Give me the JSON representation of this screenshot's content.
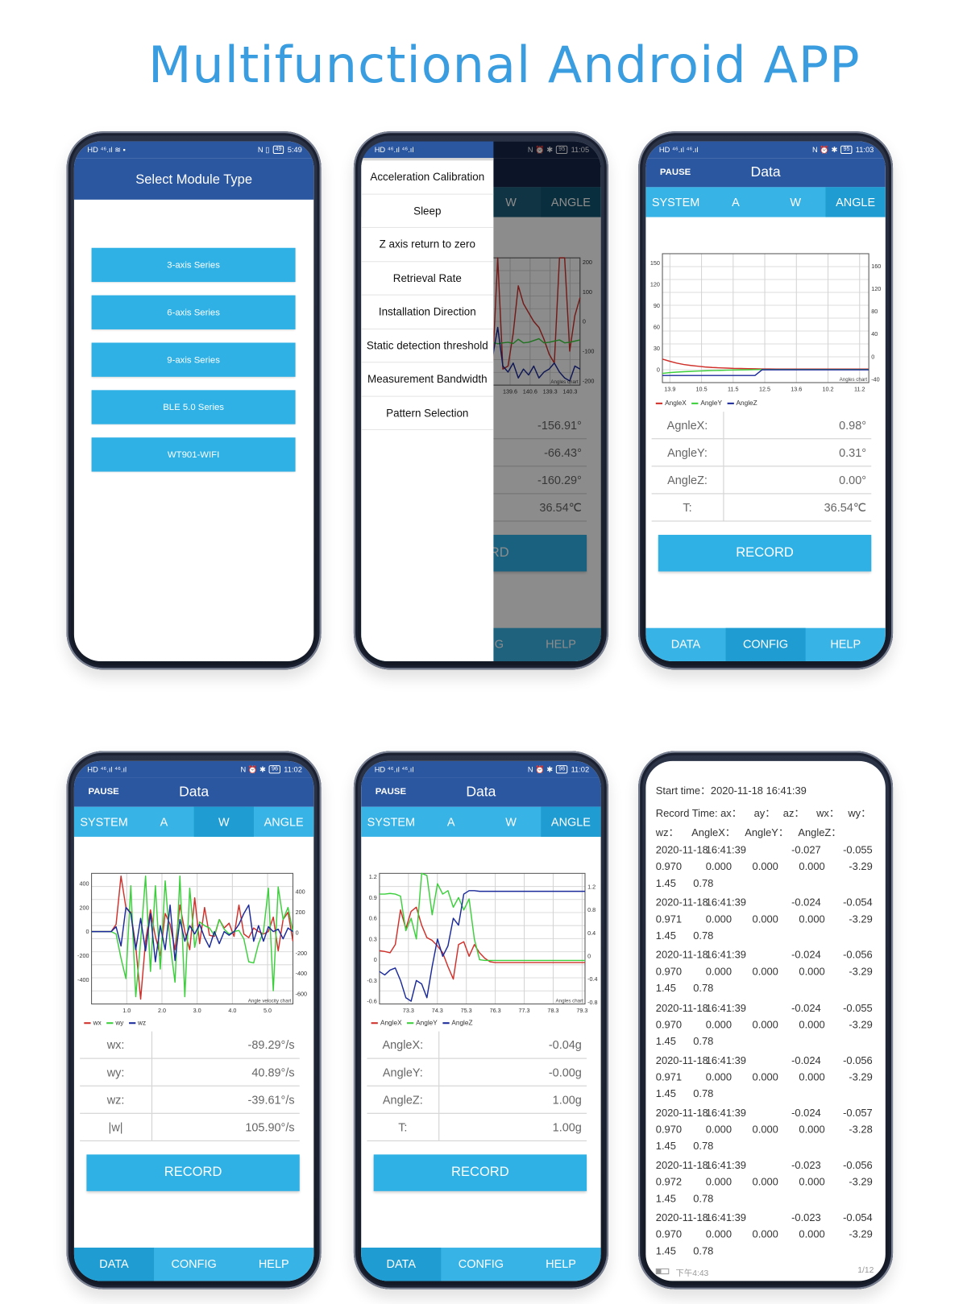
{
  "title": "Multifunctional Android APP",
  "colors": {
    "header": "#2b56a0",
    "tab": "#38b3e5",
    "tab_selected": "#1f9dd2",
    "button": "#2fb1e6",
    "title": "#3a9de0",
    "series_red": "#d0302a",
    "series_green": "#3ccf3c",
    "series_blue": "#1b2a9a"
  },
  "phones": {
    "p1": {
      "status": {
        "left_icons": "HD ⁴⁶.ıl ≋ ▪",
        "right_icons": "N ▯ ",
        "battery": "49",
        "time": "5:49"
      },
      "header_title": "Select Module Type",
      "modules": [
        "3-axis Series",
        "6-axis Series",
        "9-axis Series",
        "BLE 5.0 Series",
        "WT901-WIFI"
      ]
    },
    "p2": {
      "status": {
        "left_icons": "HD ⁴⁶.ıl ⁴⁶.ıl",
        "right_icons": "N ⏰ ✱",
        "battery": "95",
        "time": "11:05"
      },
      "menu": [
        "Acceleration Calibration",
        "Sleep",
        "Z axis return to zero",
        "Retrieval Rate",
        "Installation Direction",
        "Static detection threshold",
        "Measurement Bandwidth",
        "Pattern Selection"
      ],
      "tabs": [
        "",
        "",
        "W",
        "ANGLE"
      ],
      "values": [
        "-156.91°",
        "-66.43°",
        "-160.29°",
        "36.54℃"
      ],
      "record_label": "RECORD",
      "nav": [
        "",
        "CONFIG",
        "HELP"
      ]
    },
    "p3": {
      "status": {
        "left_icons": "HD ⁴⁶.ıl ⁴⁶.ıl",
        "right_icons": "N ⏰ ✱",
        "battery": "95",
        "time": "11:03"
      },
      "pause_label": "PAUSE",
      "header_title": "Data",
      "tabs": [
        "SYSTEM",
        "A",
        "W",
        "ANGLE"
      ],
      "selected_tab": 3,
      "table": [
        {
          "label": "AgnleX:",
          "value": "0.98°"
        },
        {
          "label": "AngleY:",
          "value": "0.31°"
        },
        {
          "label": "AngleZ:",
          "value": "0.00°"
        },
        {
          "label": "T:",
          "value": "36.54℃"
        }
      ],
      "record_label": "RECORD",
      "nav": [
        "DATA",
        "CONFIG",
        "HELP"
      ],
      "selected_nav": 1
    },
    "p4": {
      "status": {
        "left_icons": "HD ⁴⁶.ıl ⁴⁶.ıl",
        "right_icons": "N ⏰ ✱",
        "battery": "96",
        "time": "11:02"
      },
      "pause_label": "PAUSE",
      "header_title": "Data",
      "tabs": [
        "SYSTEM",
        "A",
        "W",
        "ANGLE"
      ],
      "selected_tab": 2,
      "table": [
        {
          "label": "wx:",
          "value": "-89.29°/s"
        },
        {
          "label": "wy:",
          "value": "40.89°/s"
        },
        {
          "label": "wz:",
          "value": "-39.61°/s"
        },
        {
          "label": "|w|",
          "value": "105.90°/s"
        }
      ],
      "record_label": "RECORD",
      "nav": [
        "DATA",
        "CONFIG",
        "HELP"
      ],
      "selected_nav": 0
    },
    "p5": {
      "status": {
        "left_icons": "HD ⁴⁶.ıl ⁴⁶.ıl",
        "right_icons": "N ⏰ ✱",
        "battery": "96",
        "time": "11:02"
      },
      "pause_label": "PAUSE",
      "header_title": "Data",
      "tabs": [
        "SYSTEM",
        "A",
        "W",
        "ANGLE"
      ],
      "selected_tab": 3,
      "table": [
        {
          "label": "AngleX:",
          "value": "-0.04g"
        },
        {
          "label": "AngleY:",
          "value": "-0.00g"
        },
        {
          "label": "AngleZ:",
          "value": "1.00g"
        },
        {
          "label": "T:",
          "value": "1.00g"
        }
      ],
      "record_label": "RECORD",
      "nav": [
        "DATA",
        "CONFIG",
        "HELP"
      ],
      "selected_nav": 0
    },
    "p6": {
      "start_time": "Start time：2020-11-18 16:41:39",
      "header_line1": [
        "Record Time: ax：",
        "ay：",
        "az：",
        "wx：",
        "wy："
      ],
      "header_line2": [
        "wz：",
        "AngleX：",
        "AngleY：",
        "AngleZ："
      ],
      "records": [
        {
          "date": "2020-11-18",
          "time": "16:41:39",
          "c1": "-0.027",
          "c2": "-0.055",
          "l2": [
            "0.970",
            "0.000",
            "0.000",
            "0.000",
            "-3.29"
          ],
          "l3": [
            "1.45",
            "0.78"
          ]
        },
        {
          "date": "2020-11-18",
          "time": "16:41:39",
          "c1": "-0.024",
          "c2": "-0.054",
          "l2": [
            "0.971",
            "0.000",
            "0.000",
            "0.000",
            "-3.29"
          ],
          "l3": [
            "1.45",
            "0.78"
          ]
        },
        {
          "date": "2020-11-18",
          "time": "16:41:39",
          "c1": "-0.024",
          "c2": "-0.056",
          "l2": [
            "0.970",
            "0.000",
            "0.000",
            "0.000",
            "-3.29"
          ],
          "l3": [
            "1.45",
            "0.78"
          ]
        },
        {
          "date": "2020-11-18",
          "time": "16:41:39",
          "c1": "-0.024",
          "c2": "-0.055",
          "l2": [
            "0.970",
            "0.000",
            "0.000",
            "0.000",
            "-3.29"
          ],
          "l3": [
            "1.45",
            "0.78"
          ]
        },
        {
          "date": "2020-11-18",
          "time": "16:41:39",
          "c1": "-0.024",
          "c2": "-0.056",
          "l2": [
            "0.971",
            "0.000",
            "0.000",
            "0.000",
            "-3.29"
          ],
          "l3": [
            "1.45",
            "0.78"
          ]
        },
        {
          "date": "2020-11-18",
          "time": "16:41:39",
          "c1": "-0.024",
          "c2": "-0.057",
          "l2": [
            "0.970",
            "0.000",
            "0.000",
            "0.000",
            "-3.28"
          ],
          "l3": [
            "1.45",
            "0.78"
          ]
        },
        {
          "date": "2020-11-18",
          "time": "16:41:39",
          "c1": "-0.023",
          "c2": "-0.056",
          "l2": [
            "0.972",
            "0.000",
            "0.000",
            "0.000",
            "-3.29"
          ],
          "l3": [
            "1.45",
            "0.78"
          ]
        },
        {
          "date": "2020-11-18",
          "time": "16:41:39",
          "c1": "-0.023",
          "c2": "-0.054",
          "l2": [
            "0.970",
            "0.000",
            "0.000",
            "0.000",
            "-3.29"
          ],
          "l3": [
            "1.45",
            "0.78"
          ]
        }
      ],
      "footer_time": "下午4:43",
      "footer_page": "1/12"
    }
  },
  "chart_data": [
    {
      "id": "p2",
      "type": "line",
      "chart_label": "Angles chart",
      "grid": true,
      "legend": "none",
      "xlim": [
        -0.54,
        9.5
      ],
      "x_ticks": [
        {
          "x": 6,
          "label": "139.6"
        },
        {
          "x": 7,
          "label": "140.6"
        },
        {
          "x": 8,
          "label": "139.3"
        },
        {
          "x": 9,
          "label": "140.3"
        }
      ],
      "y_ticks_left": [],
      "ylim_left": [
        -214,
        214
      ],
      "y_ticks_right": [
        200,
        100,
        0,
        -100,
        -200
      ],
      "ylim_right": [
        -214,
        214
      ],
      "series": [
        {
          "color": "#d0302a",
          "y": [
            -100,
            -90,
            -120,
            -80,
            -60,
            -100,
            -140,
            -120,
            -90,
            -60,
            -80,
            -120,
            -140,
            -100,
            -90,
            -110,
            -130,
            -150,
            -140,
            -120,
            -130,
            -140,
            -150,
            214,
            -160,
            -150,
            -40,
            120,
            60,
            30,
            0,
            -20,
            -60,
            -110,
            -140,
            214,
            214,
            -100,
            20,
            80
          ]
        },
        {
          "color": "#3ccf3c",
          "y": [
            -70,
            -65,
            -75,
            -70,
            -60,
            -72,
            -68,
            -70,
            -74,
            -66,
            -70,
            -72,
            -68,
            -65,
            -70,
            -75,
            -70,
            -68,
            -72,
            -70,
            -66,
            -62,
            -70,
            -75,
            -72,
            -70,
            -74,
            -60,
            -72,
            -70,
            -64,
            -58,
            -72,
            -70,
            -66,
            -62,
            -72,
            -70,
            -66,
            -62
          ]
        },
        {
          "color": "#1b2a9a",
          "y": [
            -150,
            -160,
            -140,
            -170,
            -150,
            -160,
            -180,
            -150,
            -140,
            -160,
            -170,
            -150,
            -160,
            -140,
            -170,
            -150,
            -160,
            -170,
            -140,
            -150,
            -160,
            -150,
            -120,
            -20,
            -150,
            -170,
            -140,
            -190,
            -160,
            -180,
            -150,
            -190,
            -170,
            -160,
            -140,
            -170,
            -190,
            -200,
            -150,
            -160
          ]
        }
      ]
    },
    {
      "id": "p3",
      "type": "line",
      "chart_label": "Angles chart",
      "grid": true,
      "legend": "bottom",
      "xlim": [
        -0.237,
        6.29
      ],
      "x_ticks": [
        {
          "x": 0,
          "label": "13.9"
        },
        {
          "x": 1,
          "label": "10.5"
        },
        {
          "x": 2,
          "label": "11.5"
        },
        {
          "x": 3,
          "label": "12.5"
        },
        {
          "x": 4,
          "label": "13.6"
        },
        {
          "x": 5,
          "label": "10.2"
        },
        {
          "x": 6,
          "label": "11.2"
        }
      ],
      "y_ticks_left": [
        150,
        120,
        90,
        60,
        30,
        0
      ],
      "ylim_left": [
        -18,
        163
      ],
      "y_ticks_right": [
        160,
        120,
        80,
        40,
        0,
        -40
      ],
      "ylim_right": [
        -46,
        182
      ],
      "series": [
        {
          "name": "AngleX",
          "color": "#d0302a",
          "y": [
            15,
            12,
            9.5,
            7.5,
            6,
            5,
            4,
            3.3,
            2.8,
            2.4,
            2,
            1.8,
            1.6,
            1.4,
            1.2,
            1.1,
            1,
            1,
            1,
            1,
            1,
            1,
            1,
            1,
            1,
            1,
            1,
            1,
            1,
            1
          ]
        },
        {
          "name": "AngleY",
          "color": "#3ccf3c",
          "y": [
            -5,
            -4,
            -3.3,
            -2.7,
            -2.2,
            -1.8,
            -1.4,
            -1.1,
            -0.8,
            -0.5,
            -0.3,
            -0.1,
            0,
            0.2,
            0.3,
            0.3,
            0.3,
            0.3,
            0.3,
            0.3,
            0.3,
            0.3,
            0.3,
            0.3,
            0.3,
            0.3,
            0.3,
            0.3,
            0.3,
            0.3
          ]
        },
        {
          "name": "AngleZ",
          "color": "#1b2a9a",
          "y": [
            -8,
            -8,
            -8,
            -8,
            -8,
            -8,
            -8,
            -8,
            -8,
            -8,
            -8,
            -8,
            -8,
            -8,
            0,
            0,
            0,
            0,
            0,
            0,
            0,
            0,
            0,
            0,
            0,
            0,
            0,
            0,
            0,
            0
          ]
        }
      ]
    },
    {
      "id": "p4",
      "type": "line",
      "chart_label": "Angle velocity chart",
      "grid": true,
      "legend": "bottom",
      "xlim": [
        0,
        5.72
      ],
      "x_ticks": [
        {
          "x": 1,
          "label": "1.0"
        },
        {
          "x": 2,
          "label": "2.0"
        },
        {
          "x": 3,
          "label": "3.0"
        },
        {
          "x": 4,
          "label": "4.0"
        },
        {
          "x": 5,
          "label": "5.0"
        }
      ],
      "y_ticks_left": [
        400,
        200,
        0,
        -200,
        -400
      ],
      "ylim_left": [
        -600,
        483
      ],
      "y_ticks_right": [
        400,
        200,
        0,
        -200,
        -400,
        -600
      ],
      "ylim_right": [
        -698,
        579
      ],
      "series": [
        {
          "name": "wx",
          "color": "#d0302a",
          "y": [
            0,
            0,
            0,
            0,
            0,
            60,
            460,
            200,
            160,
            -120,
            -560,
            -80,
            180,
            -40,
            -200,
            150,
            60,
            -150,
            220,
            0,
            -150,
            280,
            -100,
            200,
            -30,
            -40,
            100,
            30,
            70,
            -40,
            220,
            -20,
            -50,
            30,
            0,
            -20,
            0,
            120,
            -160,
            100,
            160,
            -80
          ]
        },
        {
          "name": "wy",
          "color": "#3ccf3c",
          "y": [
            0,
            0,
            0,
            0,
            0,
            -20,
            -220,
            -390,
            380,
            -540,
            -80,
            460,
            -330,
            380,
            -310,
            420,
            -100,
            -420,
            460,
            -540,
            360,
            -130,
            80,
            50,
            30,
            -30,
            100,
            20,
            -20,
            0,
            10,
            -60,
            -250,
            -260,
            -100,
            0,
            360,
            -490,
            370,
            100,
            200,
            0
          ]
        },
        {
          "name": "wz",
          "color": "#1b2a9a",
          "y": [
            0,
            0,
            0,
            0,
            0,
            40,
            -120,
            200,
            150,
            -150,
            110,
            -160,
            150,
            -250,
            50,
            -150,
            220,
            -240,
            100,
            -80,
            50,
            -20,
            60,
            -50,
            -130,
            0,
            -100,
            0,
            -30,
            0,
            60,
            150,
            220,
            -80,
            50,
            -80,
            40,
            0,
            20,
            -60,
            30,
            0
          ]
        }
      ]
    },
    {
      "id": "p5",
      "type": "line",
      "chart_label": "Angles chart",
      "grid": true,
      "legend": "bottom",
      "xlim": [
        72.3,
        79.4
      ],
      "x_ticks": [
        {
          "x": 73.3,
          "label": "73.3"
        },
        {
          "x": 74.3,
          "label": "74.3"
        },
        {
          "x": 75.3,
          "label": "75.3"
        },
        {
          "x": 76.3,
          "label": "76.3"
        },
        {
          "x": 77.3,
          "label": "77.3"
        },
        {
          "x": 78.3,
          "label": "78.3"
        },
        {
          "x": 79.3,
          "label": "79.3"
        }
      ],
      "y_ticks_left": [
        1.2,
        0.9,
        0.6,
        0.3,
        0.0,
        -0.3,
        -0.6
      ],
      "ylim_left": [
        -0.64,
        1.25
      ],
      "y_ticks_right": [
        1.2,
        0.8,
        0.4,
        0.0,
        -0.4,
        -0.8
      ],
      "ylim_right": [
        -0.83,
        1.43
      ],
      "series": [
        {
          "name": "AngleX",
          "color": "#d0302a",
          "y": [
            0.13,
            0.12,
            0.1,
            0.22,
            0.72,
            0.45,
            0.7,
            0.76,
            0.5,
            0.32,
            0.28,
            0.2,
            0.1,
            -0.1,
            -0.28,
            0.22,
            0.26,
            0.05,
            0.22,
            0.1,
            0.02,
            -0.03,
            -0.04,
            -0.04,
            -0.04,
            -0.04,
            -0.04,
            -0.04,
            -0.04,
            -0.04,
            -0.04,
            -0.04,
            -0.04,
            -0.04,
            -0.04,
            -0.04,
            -0.04,
            -0.04,
            -0.04,
            -0.04
          ]
        },
        {
          "name": "AngleY",
          "color": "#3ccf3c",
          "y": [
            0.95,
            0.95,
            0.96,
            0.95,
            0.92,
            0.42,
            0.6,
            0.3,
            1.25,
            1.22,
            0.65,
            1.1,
            0.95,
            1.0,
            0.76,
            0.9,
            0.72,
            0.88,
            0.3,
            0.0,
            -0.01,
            -0.01,
            -0.01,
            -0.01,
            -0.01,
            -0.01,
            -0.01,
            -0.01,
            -0.01,
            -0.01,
            -0.01,
            -0.01,
            -0.01,
            -0.01,
            -0.01,
            -0.01,
            -0.01,
            -0.01,
            -0.01,
            -0.01
          ]
        },
        {
          "name": "AngleZ",
          "color": "#1b2a9a",
          "y": [
            -0.17,
            -0.22,
            -0.15,
            -0.12,
            -0.3,
            -0.55,
            -0.6,
            -0.3,
            -0.35,
            -0.55,
            -0.1,
            0.3,
            0.05,
            0.2,
            0.6,
            0.5,
            0.95,
            1.0,
            1.0,
            0.99,
            0.99,
            0.99,
            0.99,
            0.99,
            0.99,
            0.99,
            0.99,
            0.99,
            0.99,
            0.99,
            0.99,
            0.99,
            0.99,
            0.99,
            0.99,
            0.99,
            0.99,
            0.99,
            0.99,
            0.99
          ]
        }
      ]
    }
  ]
}
